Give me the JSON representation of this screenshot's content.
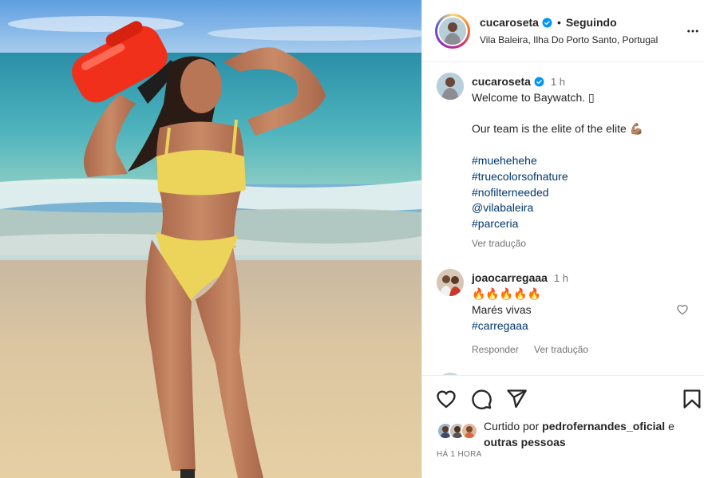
{
  "header": {
    "username": "cucaroseta",
    "separator": "•",
    "follow_status": "Seguindo",
    "location": "Vila Baleira, Ilha Do Porto Santo, Portugal",
    "more_icon": "more-horizontal-icon"
  },
  "caption": {
    "username": "cucaroseta",
    "time": "1 h",
    "lines": [
      "Welcome to Baywatch. ▯",
      "Our team is the elite of the elite 💪🏽"
    ],
    "hashtags": [
      "#muehehehe",
      "#truecolorsofnature",
      "#nofilterneeded",
      "@vilabaleira",
      "#parceria"
    ],
    "see_translation": "Ver tradução"
  },
  "comment": {
    "username": "joaocarregaaa",
    "time": "1 h",
    "emoji": "🔥🔥🔥🔥🔥",
    "text": "Marés vivas",
    "hashtag": "#carregaaa",
    "reply": "Responder",
    "see_translation": "Ver tradução",
    "heart_icon": "heart-outline-icon"
  },
  "actions": {
    "icons": [
      "heart-icon",
      "comment-icon",
      "share-icon",
      "bookmark-icon"
    ],
    "liked_prefix": "Curtido por",
    "liked_user": "pedrofernandes_oficial",
    "liked_joiner": "e",
    "liked_others": "outras pessoas",
    "time_ago": "HÁ 1 HORA"
  }
}
